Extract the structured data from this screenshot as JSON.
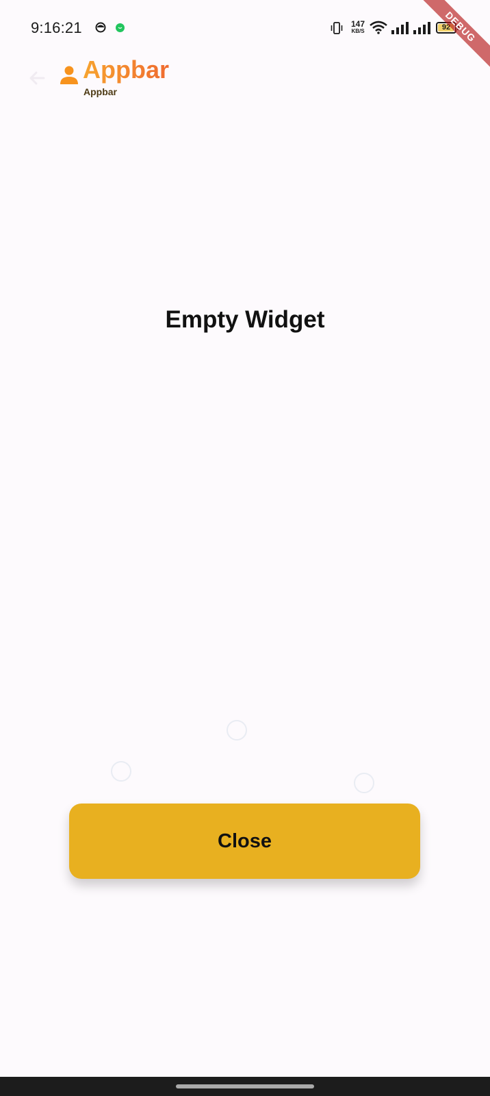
{
  "status_bar": {
    "time": "9:16:21",
    "net_speed_value": "147",
    "net_speed_unit": "KB/S",
    "battery_level": "92",
    "icons": [
      "app-icon",
      "whatsapp-icon",
      "vibrate-icon",
      "wifi-icon",
      "signal-icon",
      "signal-icon",
      "battery-icon"
    ]
  },
  "debug_banner": {
    "label": "DEBUG",
    "color": "#b71c1c"
  },
  "app_bar": {
    "title": "Appbar",
    "subtitle": "Appbar",
    "title_gradient": [
      "#f7a42f",
      "#ef6a2f"
    ],
    "subtitle_color": "#4d3a14",
    "icons": [
      "back-arrow-icon",
      "user-icon"
    ]
  },
  "main": {
    "message": "Empty Widget"
  },
  "actions": {
    "close_label": "Close",
    "close_color": "#e8b020"
  }
}
